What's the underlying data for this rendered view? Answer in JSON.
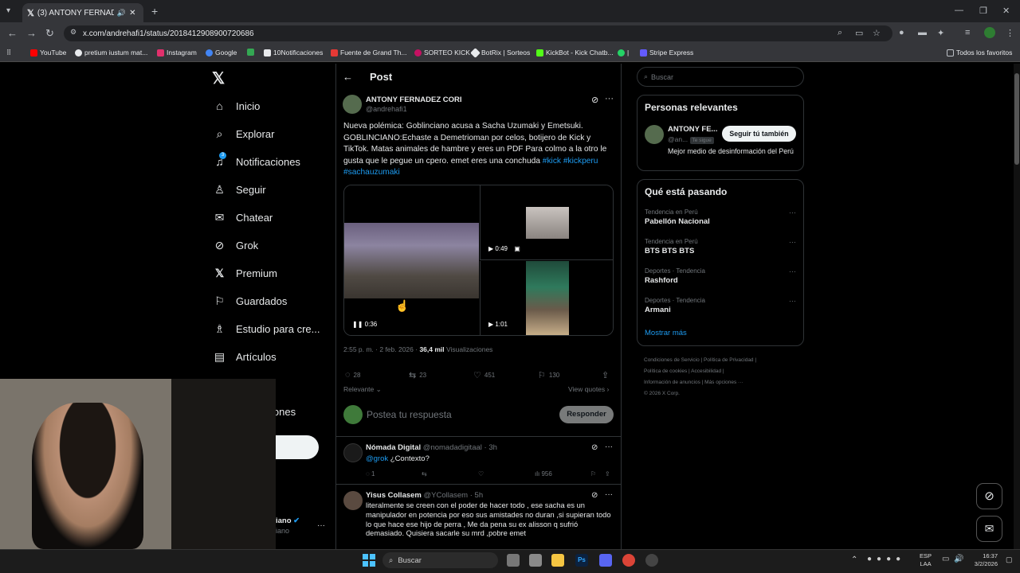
{
  "browser": {
    "tab_title": "(3) ANTONY FERNADEZ CO",
    "url": "x.com/andrehafi1/status/2018412908900720686",
    "bookmarks": [
      {
        "label": "YouTube",
        "color": "#ff0000"
      },
      {
        "label": "pretium iustum mat...",
        "color": "#e8eaed"
      },
      {
        "label": "Instagram",
        "color": "#e1306c"
      },
      {
        "label": "Google",
        "color": "#4285f4"
      },
      {
        "label": "",
        "color": "#34a853"
      },
      {
        "label": "10Notificaciones",
        "color": "#e8eaed"
      },
      {
        "label": "Fuente de Grand Th...",
        "color": "#e53935"
      },
      {
        "label": "SORTEO KICK",
        "color": "#c51162"
      },
      {
        "label": "BotRix | Sorteos",
        "color": "#e8eaed"
      },
      {
        "label": "KickBot - Kick Chatb...",
        "color": "#53fc18"
      },
      {
        "label": "|",
        "color": "#25d366"
      },
      {
        "label": "Stripe Express",
        "color": "#635bff"
      }
    ],
    "all_bookmarks": "Todos los favoritos"
  },
  "sidebar": {
    "items": [
      {
        "label": "Inicio",
        "icon": "home-icon"
      },
      {
        "label": "Explorar",
        "icon": "search-icon"
      },
      {
        "label": "Notificaciones",
        "icon": "bell-icon"
      },
      {
        "label": "Seguir",
        "icon": "follow-icon"
      },
      {
        "label": "Chatear",
        "icon": "mail-icon"
      },
      {
        "label": "Grok",
        "icon": "grok-icon"
      },
      {
        "label": "Premium",
        "icon": "x-icon"
      },
      {
        "label": "Guardados",
        "icon": "bookmark-icon"
      },
      {
        "label": "Estudio para cre...",
        "icon": "studio-icon"
      },
      {
        "label": "Artículos",
        "icon": "articles-icon"
      }
    ],
    "notif_badge": "3",
    "partial_more": "iones",
    "account_partial_name": "iano",
    "account_partial_handle": "iano"
  },
  "post": {
    "header": "Post",
    "author_name": "ANTONY FERNADEZ CORI",
    "author_handle": "@andrehafi1",
    "text": "Nueva polémica: Goblinciano acusa a Sacha Uzumaki y Emetsuki. GOBLINCIANO:Echaste a Demetrioman por celos, botijero de Kick y TikTok. Matas animales de hambre y eres un PDF Para colmo a la otro le gusta que le pegue un cpero. emet eres una conchuda",
    "hashtags": [
      "#kick",
      "#kickperu",
      "#sachauzumaki"
    ],
    "videos": [
      {
        "duration": "0:36",
        "state": "pause"
      },
      {
        "duration": "0:49",
        "state": "play"
      },
      {
        "duration": "1:01",
        "state": "play"
      }
    ],
    "timestamp": "2:55 p. m. · 2 feb. 2026 · ",
    "views_count": "36,4 mil",
    "views_label": " Visualizaciones",
    "replies": "28",
    "reposts": "23",
    "likes": "451",
    "bookmarks": "130",
    "sort_label": "Relevante",
    "view_quotes": "View quotes",
    "reply_placeholder": "Postea tu respuesta",
    "reply_button": "Responder"
  },
  "replies": [
    {
      "name": "Nómada Digital",
      "handle": "@nomadadigitaal",
      "time": "· 3h",
      "mention": "@grok",
      "text": " ¿Contexto?",
      "replies": "1",
      "likes": "",
      "views": "956"
    },
    {
      "name": "Yisus Collasem",
      "handle": "@YCollasem",
      "time": "· 5h",
      "mention": "",
      "text": "literalmente se creen con el poder de hacer todo , ese sacha es un manipulador en potencia por eso sus amistades no duran ,si supieran todo lo que hace ese hijo de perra , Me da pena su ex alisson q sufrió demasiado. Quisiera sacarle su mrd ,pobre emet"
    }
  ],
  "right": {
    "search_placeholder": "Buscar",
    "relevant_title": "Personas relevantes",
    "relevant_name": "ANTONY FE...",
    "relevant_handle": "@an...",
    "follows_you": "Te sigue",
    "follow_back": "Seguir tú también",
    "relevant_bio": "Mejor medio de desinformación del Perú",
    "trends_title": "Qué está pasando",
    "trends": [
      {
        "meta": "Tendencia en Perú",
        "name": "Pabellón Nacional"
      },
      {
        "meta": "Tendencia en Perú",
        "name": "BTS BTS BTS"
      },
      {
        "meta": "Deportes · Tendencia",
        "name": "Rashford"
      },
      {
        "meta": "Deportes · Tendencia",
        "name": "Armani"
      }
    ],
    "show_more": "Mostrar más",
    "footer": [
      "Condiciones de Servicio",
      "Política de Privacidad",
      "Política de cookies",
      "Accesibilidad",
      "Información de anuncios",
      "Más opciones ···",
      "© 2026 X Corp."
    ]
  },
  "taskbar": {
    "search": "Buscar",
    "lang1": "ESP",
    "lang2": "LAA",
    "time": "16:37",
    "date": "3/2/2026"
  },
  "colors": {
    "accent": "#1d9bf0",
    "bg": "#000000",
    "border": "#2f3336"
  }
}
